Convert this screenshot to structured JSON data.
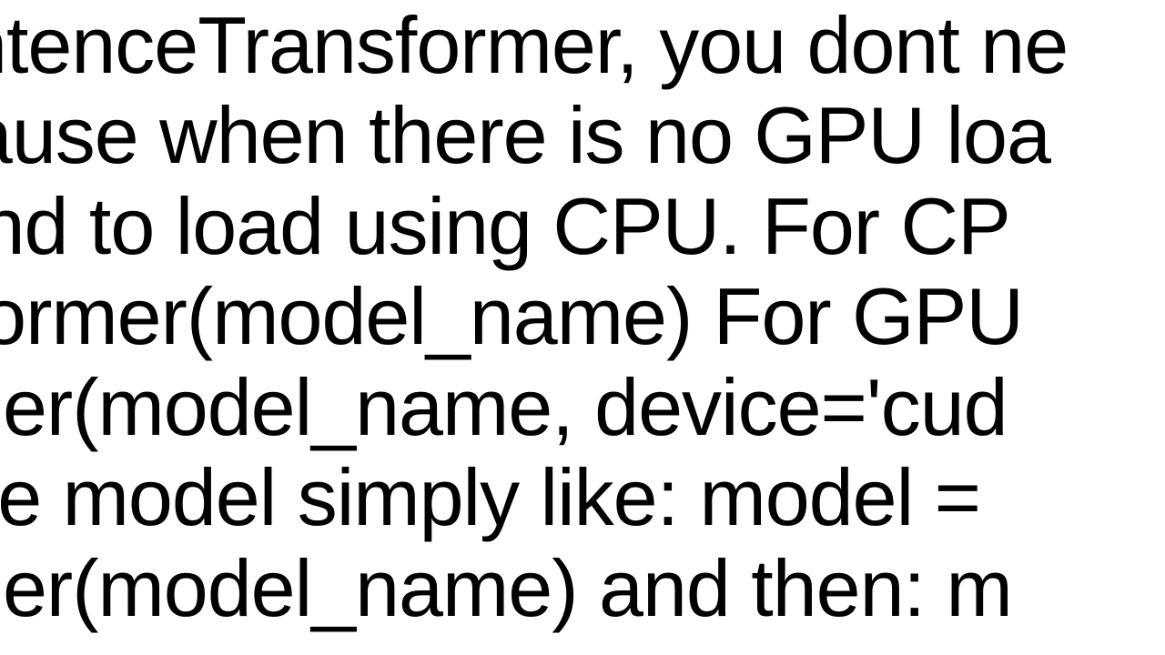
{
  "content": {
    "line1": "ith SentenceTransformer, you dont ne",
    "line2": "U because when there is no GPU loa",
    "line3": "derstand to load using CPU. For CP",
    "line4": "Transformer(model_name)  For GPU",
    "line5": "nsformer(model_name, device='cud",
    "line6": "  load the model simply like: model =",
    "line7": "nsformer(model_name)  and then: m"
  }
}
